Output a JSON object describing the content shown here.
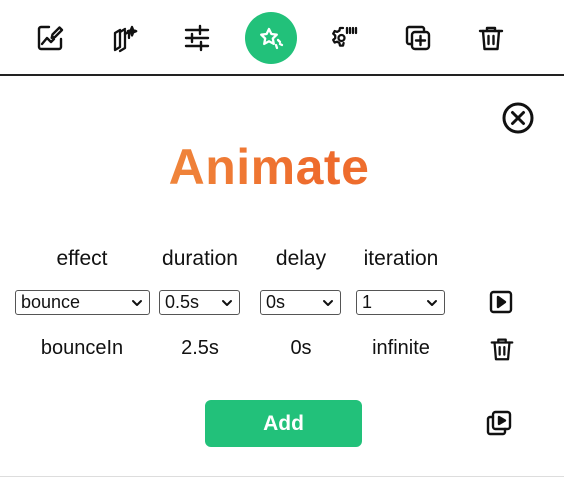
{
  "toolbar": {
    "items": [
      {
        "icon": "edit-image-icon"
      },
      {
        "icon": "magic-layers-icon"
      },
      {
        "icon": "sliders-icon"
      },
      {
        "icon": "star-sparkle-icon",
        "active": true
      },
      {
        "icon": "gear-barcode-icon"
      },
      {
        "icon": "duplicate-add-icon"
      },
      {
        "icon": "trash-icon"
      }
    ],
    "active_color": "#22c17a"
  },
  "panel": {
    "title": "Animate",
    "close_icon": "close-circle-icon",
    "columns": {
      "effect": "effect",
      "duration": "duration",
      "delay": "delay",
      "iteration": "iteration"
    },
    "editor": {
      "effect": "bounce",
      "duration": "0.5s",
      "delay": "0s",
      "iteration": "1",
      "play_icon": "play-icon"
    },
    "rows": [
      {
        "effect": "bounceIn",
        "duration": "2.5s",
        "delay": "0s",
        "iteration": "infinite",
        "delete_icon": "trash-icon"
      }
    ],
    "add_label": "Add",
    "preview_icon": "preview-play-icon",
    "add_color": "#22c17a",
    "title_colors": [
      "#f1a24a",
      "#ee6a2c"
    ]
  }
}
